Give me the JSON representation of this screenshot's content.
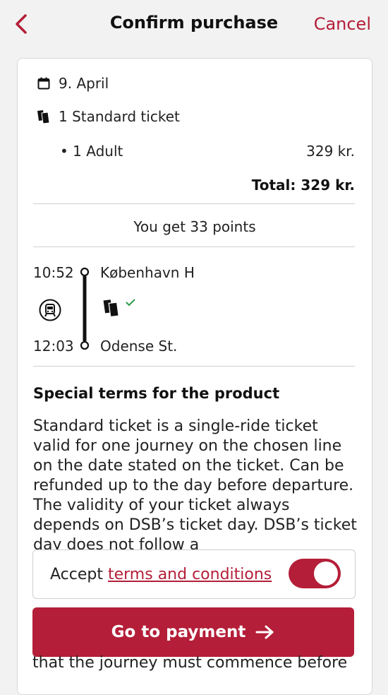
{
  "header": {
    "title": "Confirm purchase",
    "cancel_label": "Cancel"
  },
  "summary": {
    "date": "9. April",
    "ticket_line": "1 Standard ticket",
    "passenger_line": "• 1 Adult",
    "passenger_price": "329 kr.",
    "total": "Total: 329 kr.",
    "points": "You get 33 points"
  },
  "journey": {
    "depart_time": "10:52",
    "depart_station": "København H",
    "arrive_time": "12:03",
    "arrive_station": "Odense St."
  },
  "terms": {
    "title": "Special terms for the product",
    "body": "Standard ticket is a single-ride ticket valid for one journey on the chosen line on the date stated on the ticket. Can be refunded up to the day before departure. The validity of your ticket always depends on DSB’s ticket day. DSB’s ticket day does not follow a",
    "hidden_tail": "that the journey must commence before"
  },
  "accept": {
    "prefix": "Accept",
    "link": "terms and conditions",
    "toggle_on": true
  },
  "payment": {
    "button_label": "Go to payment"
  },
  "colors": {
    "brand": "#b41e38",
    "check": "#2e9a48"
  }
}
